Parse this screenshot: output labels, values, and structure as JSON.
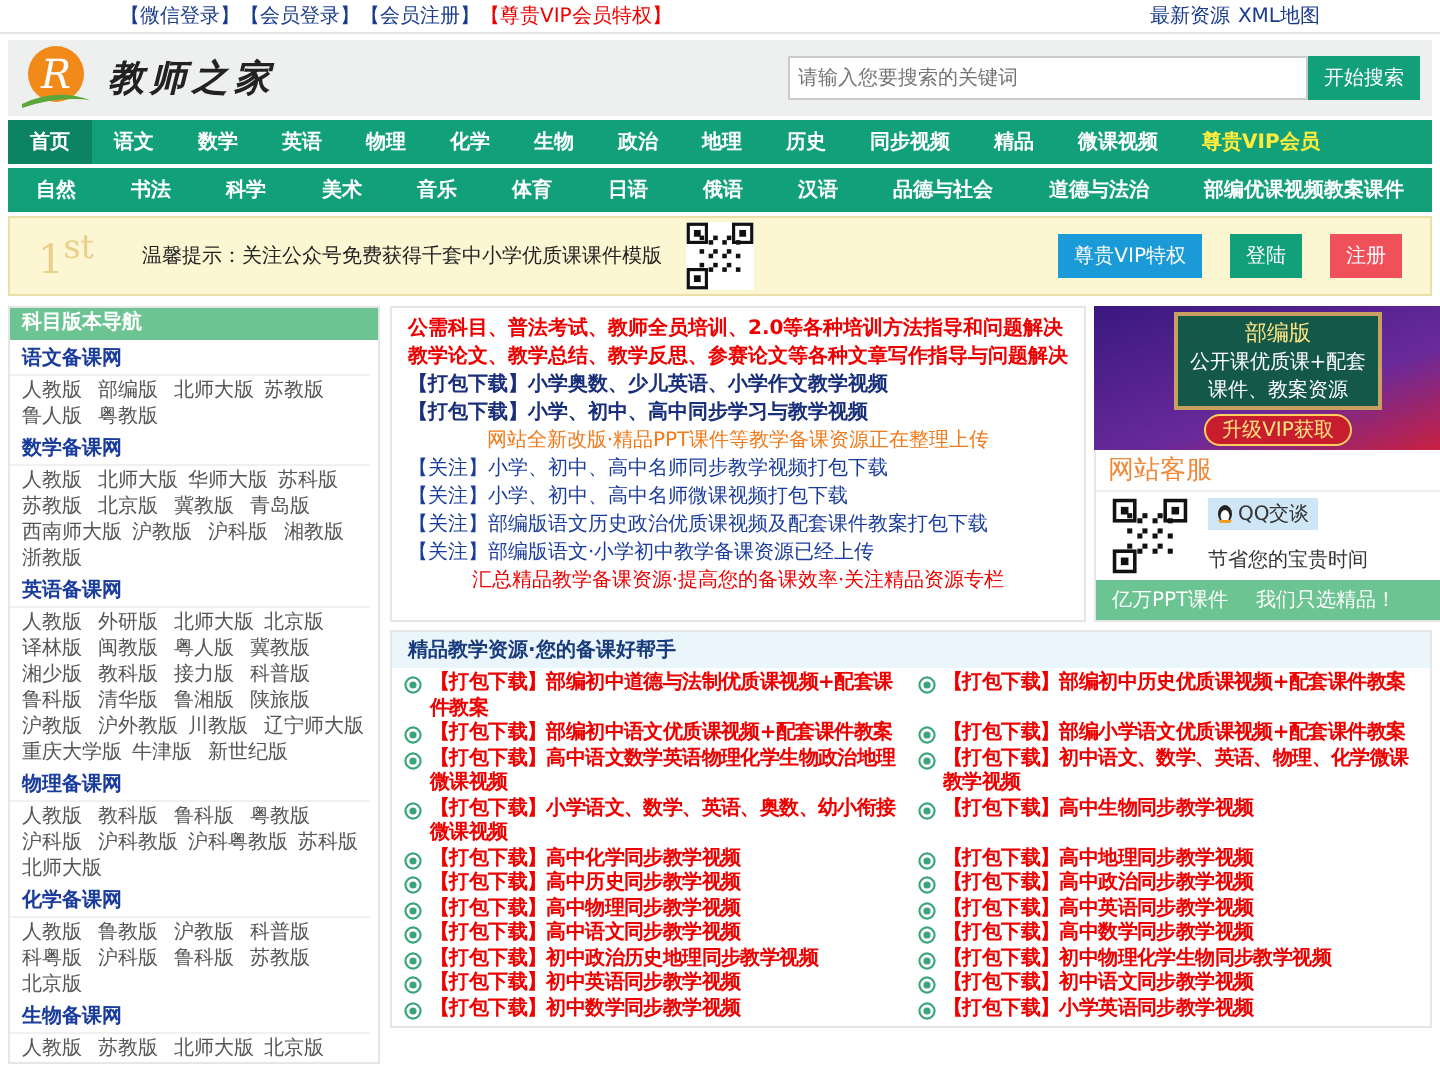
{
  "top_bar": {
    "links": [
      {
        "label": "【微信登录】",
        "highlight": false
      },
      {
        "label": "【会员登录】",
        "highlight": false
      },
      {
        "label": "【会员注册】",
        "highlight": false
      },
      {
        "label": "【尊贵VIP会员特权】",
        "highlight": true
      }
    ],
    "right_links": [
      "最新资源",
      "XML地图"
    ]
  },
  "header": {
    "logo_mark": "R",
    "site_name": "教师之家",
    "search": {
      "placeholder": "请输入您要搜索的关键词",
      "button": "开始搜索"
    }
  },
  "nav_primary": [
    {
      "label": "首页",
      "selected": true,
      "highlight": false
    },
    {
      "label": "语文",
      "selected": false,
      "highlight": false
    },
    {
      "label": "数学",
      "selected": false,
      "highlight": false
    },
    {
      "label": "英语",
      "selected": false,
      "highlight": false
    },
    {
      "label": "物理",
      "selected": false,
      "highlight": false
    },
    {
      "label": "化学",
      "selected": false,
      "highlight": false
    },
    {
      "label": "生物",
      "selected": false,
      "highlight": false
    },
    {
      "label": "政治",
      "selected": false,
      "highlight": false
    },
    {
      "label": "地理",
      "selected": false,
      "highlight": false
    },
    {
      "label": "历史",
      "selected": false,
      "highlight": false
    },
    {
      "label": "同步视频",
      "selected": false,
      "highlight": false
    },
    {
      "label": "精品",
      "selected": false,
      "highlight": false
    },
    {
      "label": "微课视频",
      "selected": false,
      "highlight": false
    },
    {
      "label": "尊贵VIP会员",
      "selected": false,
      "highlight": true
    }
  ],
  "nav_secondary": [
    "自然",
    "书法",
    "科学",
    "美术",
    "音乐",
    "体育",
    "日语",
    "俄语",
    "汉语",
    "品德与社会",
    "道德与法治",
    "部编优课视频教案课件"
  ],
  "notice_banner": {
    "badge": "1$^{st}$",
    "text": "温馨提示：关注公众号免费获得千套中小学优质课课件模版",
    "buttons": [
      {
        "label": "尊贵VIP特权",
        "kind": "vip"
      },
      {
        "label": "登陆",
        "kind": "login"
      },
      {
        "label": "注册",
        "kind": "register"
      }
    ]
  },
  "sidebar": {
    "title": "科目版本导航",
    "groups": [
      {
        "title": "语文备课网",
        "rows": [
          [
            "人教版",
            "部编版",
            "北师大版",
            "苏教版"
          ],
          [
            "鲁人版",
            "粤教版"
          ]
        ]
      },
      {
        "title": "数学备课网",
        "rows": [
          [
            "人教版",
            "北师大版",
            "华师大版",
            "苏科版"
          ],
          [
            "苏教版",
            "北京版",
            "冀教版",
            "青岛版"
          ],
          [
            "西南师大版",
            "沪教版",
            "沪科版",
            "湘教版"
          ],
          [
            "浙教版"
          ]
        ]
      },
      {
        "title": "英语备课网",
        "rows": [
          [
            "人教版",
            "外研版",
            "北师大版",
            "北京版"
          ],
          [
            "译林版",
            "闽教版",
            "粤人版",
            "冀教版"
          ],
          [
            "湘少版",
            "教科版",
            "接力版",
            "科普版"
          ],
          [
            "鲁科版",
            "清华版",
            "鲁湘版",
            "陕旅版"
          ],
          [
            "沪教版",
            "沪外教版",
            "川教版",
            "辽宁师大版"
          ],
          [
            "重庆大学版",
            "牛津版",
            "新世纪版"
          ]
        ]
      },
      {
        "title": "物理备课网",
        "rows": [
          [
            "人教版",
            "教科版",
            "鲁科版",
            "粤教版"
          ],
          [
            "沪科版",
            "沪科教版",
            "沪科粤教版",
            "苏科版"
          ],
          [
            "北师大版"
          ]
        ]
      },
      {
        "title": "化学备课网",
        "rows": [
          [
            "人教版",
            "鲁教版",
            "沪教版",
            "科普版"
          ],
          [
            "科粤版",
            "沪科版",
            "鲁科版",
            "苏教版"
          ],
          [
            "北京版"
          ]
        ]
      },
      {
        "title": "生物备课网",
        "rows": [
          [
            "人教版",
            "苏教版",
            "北师大版",
            "北京版"
          ]
        ]
      }
    ]
  },
  "headlines": [
    {
      "text": "公需科目、普法考试、教师全员培训、2.0等各种培训方法指导和问题解决",
      "kind": "hot"
    },
    {
      "text": "教学论文、教学总结、教学反思、参赛论文等各种文章写作指导与问题解决",
      "kind": "hot"
    },
    {
      "text": "【打包下载】小学奥数、少儿英语、小学作文教学视频",
      "kind": "pack"
    },
    {
      "text": "【打包下载】小学、初中、高中同步学习与教学视频",
      "kind": "pack"
    },
    {
      "text": "网站全新改版·精品PPT课件等教学备课资源正在整理上传",
      "kind": "notice"
    },
    {
      "text": "【关注】小学、初中、高中名师同步教学视频打包下载",
      "kind": "follow"
    },
    {
      "text": "【关注】小学、初中、高中名师微课视频打包下载",
      "kind": "follow"
    },
    {
      "text": "【关注】部编版语文历史政治优质课视频及配套课件教案打包下载",
      "kind": "follow"
    },
    {
      "text": "【关注】部编版语文·小学初中教学备课资源已经上传",
      "kind": "follow"
    },
    {
      "text": "汇总精品教学备课资源·提高您的备课效率·关注精品资源专栏",
      "kind": "promo"
    }
  ],
  "ad_banner": {
    "title": "部编版",
    "lines": [
      "公开课优质课+配套",
      "课件、教案资源"
    ],
    "button": "升级VIP获取"
  },
  "support": {
    "title": "网站客服",
    "qq_button": "QQ交谈",
    "note": "节省您的宝贵时间",
    "footer": [
      "亿万PPT课件",
      "我们只选精品！"
    ]
  },
  "resources": {
    "title": "精品教学资源·您的备课好帮手",
    "items": [
      "【打包下载】部编初中道德与法制优质课视频+配套课件教案",
      "【打包下载】部编初中历史优质课视频+配套课件教案",
      "【打包下载】部编初中语文优质课视频+配套课件教案",
      "【打包下载】部编小学语文优质课视频+配套课件教案",
      "【打包下载】高中语文数学英语物理化学生物政治地理微课视频",
      "【打包下载】初中语文、数学、英语、物理、化学微课教学视频",
      "【打包下载】小学语文、数学、英语、奥数、幼小衔接微课视频",
      "【打包下载】高中生物同步教学视频",
      "【打包下载】高中化学同步教学视频",
      "【打包下载】高中地理同步教学视频",
      "【打包下载】高中历史同步教学视频",
      "【打包下载】高中政治同步教学视频",
      "【打包下载】高中物理同步教学视频",
      "【打包下载】高中英语同步教学视频",
      "【打包下载】高中语文同步教学视频",
      "【打包下载】高中数学同步教学视频",
      "【打包下载】初中政治历史地理同步教学视频",
      "【打包下载】初中物理化学生物同步教学视频",
      "【打包下载】初中英语同步教学视频",
      "【打包下载】初中语文同步教学视频",
      "【打包下载】初中数学同步教学视频",
      "【打包下载】小学英语同步教学视频"
    ]
  }
}
